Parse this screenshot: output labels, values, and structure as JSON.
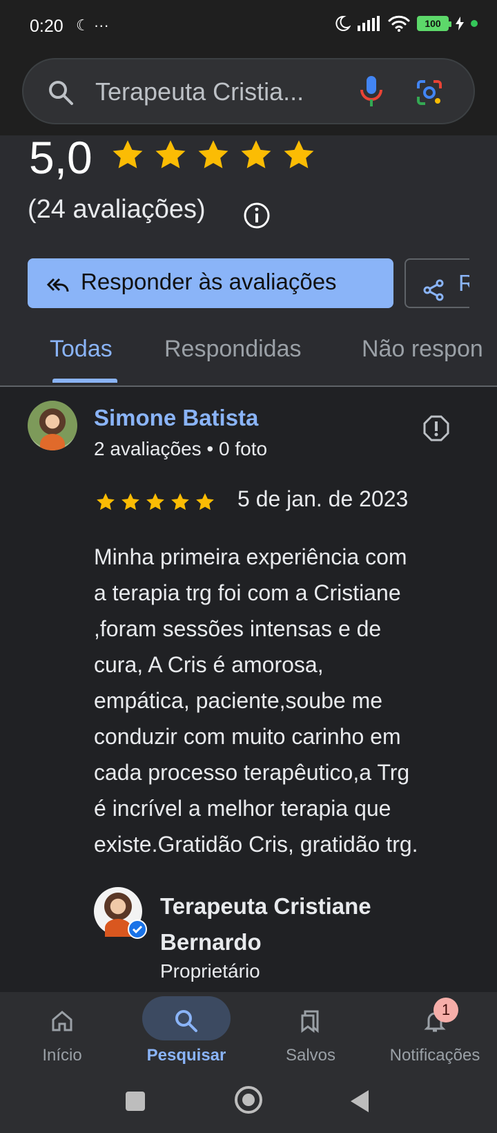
{
  "status_bar": {
    "time": "0:20",
    "left_icons": "☾ ···",
    "battery": "100"
  },
  "search": {
    "query": "Terapeuta Cristia..."
  },
  "rating": {
    "score": "5,0",
    "stars": 5,
    "count_text": "(24 avaliações)"
  },
  "actions": {
    "reply_label": "Responder às avaliações",
    "share_label": "R"
  },
  "tabs": [
    {
      "label": "Todas"
    },
    {
      "label": "Respondidas"
    },
    {
      "label": "Não respon"
    }
  ],
  "review": {
    "author": "Simone Batista",
    "meta": "2 avaliações • 0 foto",
    "stars": 5,
    "date": "5 de jan. de 2023",
    "text": "Minha primeira experiência com\na terapia trg foi com a Cristiane\n,foram sessões intensas e de\ncura, A Cris é amorosa,\nempática, paciente,soube me\nconduzir com muito carinho em\ncada processo terapêutico,a Trg\né incrível a melhor terapia que\nexiste.Gratidão Cris, gratidão trg.",
    "owner_name": "Terapeuta Cristiane Bernardo",
    "owner_role": "Proprietário"
  },
  "bottom_nav": [
    {
      "label": "Início",
      "icon": "home-icon"
    },
    {
      "label": "Pesquisar",
      "icon": "search-icon"
    },
    {
      "label": "Salvos",
      "icon": "bookmarks-icon"
    },
    {
      "label": "Notificações",
      "icon": "bell-icon"
    }
  ],
  "notifications_badge": "1",
  "colors": {
    "accent": "#8ab4f8",
    "star": "#fbbc04",
    "background": "#202124"
  }
}
